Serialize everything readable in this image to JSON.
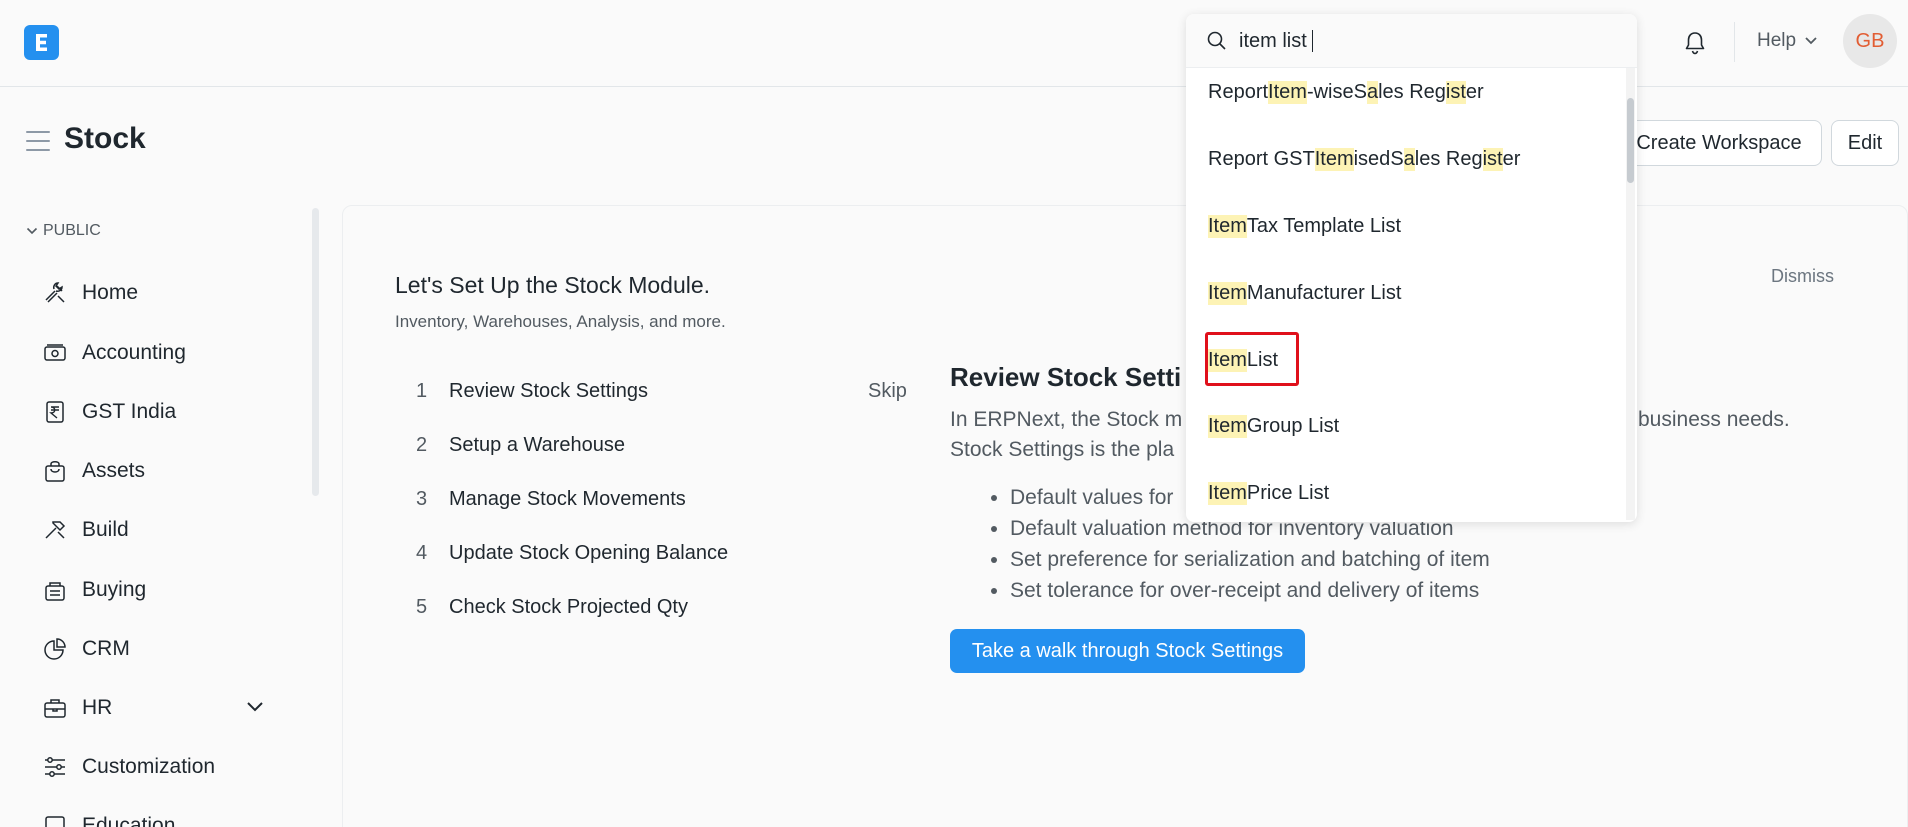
{
  "app": {
    "logo_letter": "E",
    "accent": "#2490ef"
  },
  "navbar": {
    "help_label": "Help",
    "avatar_initials": "GB"
  },
  "page": {
    "title": "Stock",
    "create_workspace_label": "Create Workspace",
    "edit_label": "Edit"
  },
  "sidebar": {
    "section_label": "PUBLIC",
    "items": [
      {
        "label": "Home",
        "icon": "tools-icon"
      },
      {
        "label": "Accounting",
        "icon": "money-icon"
      },
      {
        "label": "GST India",
        "icon": "rupee-receipt-icon"
      },
      {
        "label": "Assets",
        "icon": "bag-icon"
      },
      {
        "label": "Build",
        "icon": "hammer-icon"
      },
      {
        "label": "Buying",
        "icon": "cart-icon"
      },
      {
        "label": "CRM",
        "icon": "pie-icon"
      },
      {
        "label": "HR",
        "icon": "briefcase-icon"
      },
      {
        "label": "Customization",
        "icon": "sliders-icon"
      },
      {
        "label": "Education",
        "icon": "book-icon"
      }
    ]
  },
  "onboarding": {
    "title": "Let's Set Up the Stock Module.",
    "subtitle": "Inventory, Warehouses, Analysis, and more.",
    "dismiss_label": "Dismiss",
    "skip_label": "Skip",
    "steps": [
      {
        "num": "1",
        "label": "Review Stock Settings"
      },
      {
        "num": "2",
        "label": "Setup a Warehouse"
      },
      {
        "num": "3",
        "label": "Manage Stock Movements"
      },
      {
        "num": "4",
        "label": "Update Stock Opening Balance"
      },
      {
        "num": "5",
        "label": "Check Stock Projected Qty"
      }
    ],
    "detail": {
      "title": "Review Stock Setti",
      "line1": "In ERPNext, the Stock m",
      "line1_end": "business needs.",
      "line2": "Stock Settings is the pla",
      "bullets": [
        "Default values for",
        "Default valuation method for inventory valuation",
        "Set preference for serialization and batching of item",
        "Set tolerance for over-receipt and delivery of items"
      ],
      "cta_label": "Take a walk through Stock Settings"
    }
  },
  "search": {
    "value": "item list",
    "results": [
      [
        {
          "t": "Report "
        },
        {
          "t": "Item",
          "h": true
        },
        {
          "t": "-wise "
        },
        {
          "t": "",
          "h": true
        },
        {
          "t": "S"
        },
        {
          "t": "a",
          "h": true
        },
        {
          "t": "les Reg"
        },
        {
          "t": "ist",
          "h": true
        },
        {
          "t": "er"
        }
      ],
      [
        {
          "t": "Report GST "
        },
        {
          "t": "Item",
          "h": true
        },
        {
          "t": "ised "
        },
        {
          "t": "S"
        },
        {
          "t": "a",
          "h": true
        },
        {
          "t": "les Reg"
        },
        {
          "t": "ist",
          "h": true
        },
        {
          "t": "er"
        }
      ],
      [
        {
          "t": "Item",
          "h": true
        },
        {
          "t": " Tax Template List"
        }
      ],
      [
        {
          "t": "Item",
          "h": true
        },
        {
          "t": " Manufacturer List"
        }
      ],
      [
        {
          "t": "Item",
          "h": true
        },
        {
          "t": " List"
        }
      ],
      [
        {
          "t": "Item",
          "h": true
        },
        {
          "t": " Group List"
        }
      ],
      [
        {
          "t": "Item",
          "h": true
        },
        {
          "t": " Price List"
        }
      ]
    ]
  }
}
